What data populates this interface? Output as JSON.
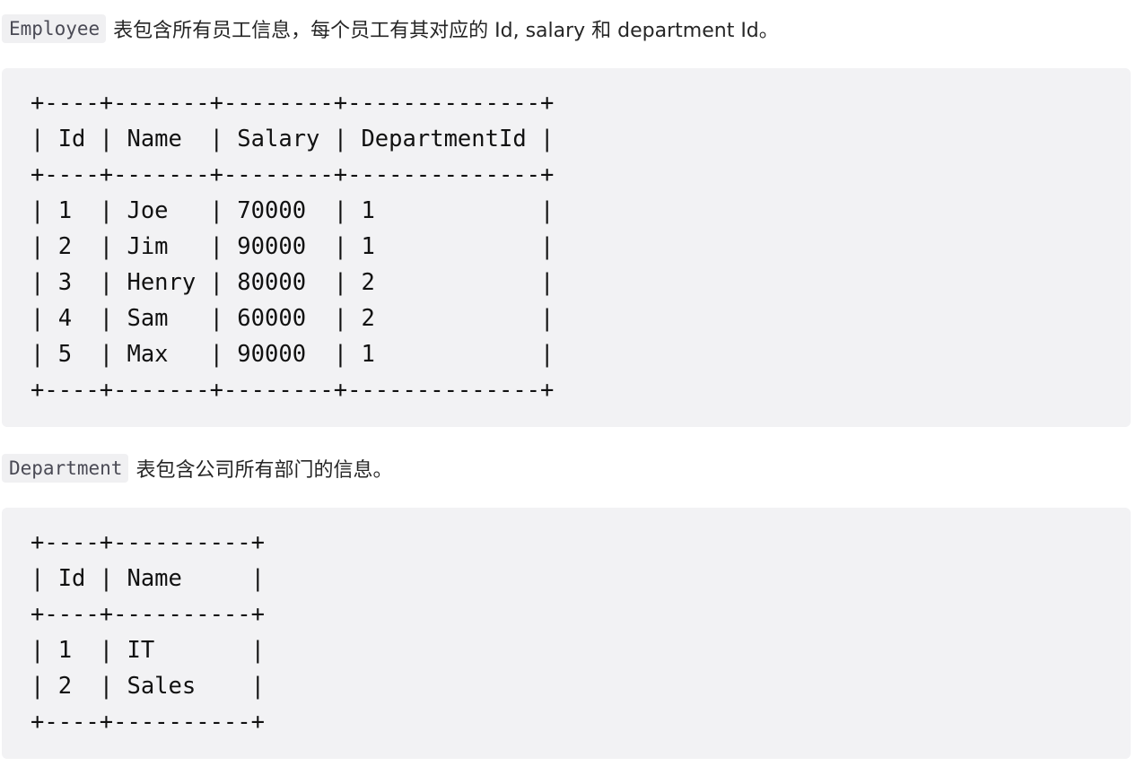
{
  "intro_employee": {
    "code": "Employee",
    "text": "表包含所有员工信息，每个员工有其对应的 Id, salary 和 department Id。"
  },
  "employee_table": [
    "+----+-------+--------+--------------+",
    "| Id | Name  | Salary | DepartmentId |",
    "+----+-------+--------+--------------+",
    "| 1  | Joe   | 70000  | 1            |",
    "| 2  | Jim   | 90000  | 1            |",
    "| 3  | Henry | 80000  | 2            |",
    "| 4  | Sam   | 60000  | 2            |",
    "| 5  | Max   | 90000  | 1            |",
    "+----+-------+--------+--------------+"
  ],
  "intro_department": {
    "code": "Department",
    "text": "表包含公司所有部门的信息。"
  },
  "department_table": [
    "+----+----------+",
    "| Id | Name     |",
    "+----+----------+",
    "| 1  | IT       |",
    "| 2  | Sales    |",
    "+----+----------+"
  ],
  "colors": {
    "code_background": "#f2f2f4",
    "inline_code_background": "#f0f0f2",
    "text": "#262626"
  }
}
